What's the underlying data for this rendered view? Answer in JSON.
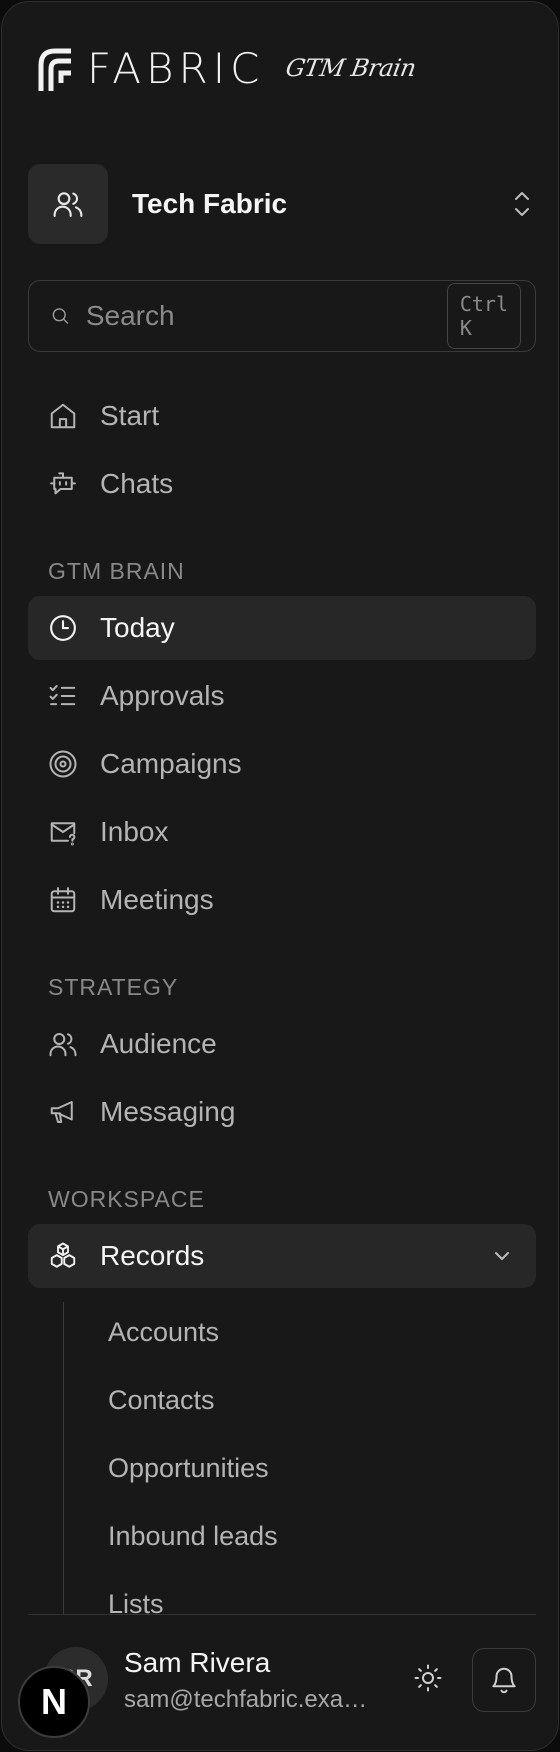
{
  "brand": {
    "wordmark": "FABRIC",
    "subtitle": "GTM Brain"
  },
  "workspace": {
    "name": "Tech Fabric"
  },
  "search": {
    "placeholder": "Search",
    "shortcut": "Ctrl K"
  },
  "nav_top": [
    {
      "label": "Start",
      "icon": "home-icon"
    },
    {
      "label": "Chats",
      "icon": "bot-chat-icon"
    }
  ],
  "sections": {
    "gtm_brain": {
      "label": "GTM BRAIN",
      "items": [
        {
          "label": "Today",
          "icon": "clock-icon",
          "active": true
        },
        {
          "label": "Approvals",
          "icon": "checklist-icon"
        },
        {
          "label": "Campaigns",
          "icon": "target-icon"
        },
        {
          "label": "Inbox",
          "icon": "mail-question-icon"
        },
        {
          "label": "Meetings",
          "icon": "calendar-icon"
        }
      ]
    },
    "strategy": {
      "label": "STRATEGY",
      "items": [
        {
          "label": "Audience",
          "icon": "users-icon"
        },
        {
          "label": "Messaging",
          "icon": "megaphone-icon"
        }
      ]
    },
    "workspace": {
      "label": "WORKSPACE",
      "items": [
        {
          "label": "Records",
          "icon": "boxes-icon",
          "expanded": true
        }
      ],
      "sub_items": [
        "Accounts",
        "Contacts",
        "Opportunities",
        "Inbound leads",
        "Lists"
      ]
    }
  },
  "user": {
    "initials": "SR",
    "name": "Sam Rivera",
    "email": "sam@techfabric.example.com"
  },
  "floating_badge": "N",
  "colors": {
    "background": "#181818",
    "active_item": "#272727",
    "text": "#f5f5f5",
    "muted_text": "#b4b4b4"
  }
}
